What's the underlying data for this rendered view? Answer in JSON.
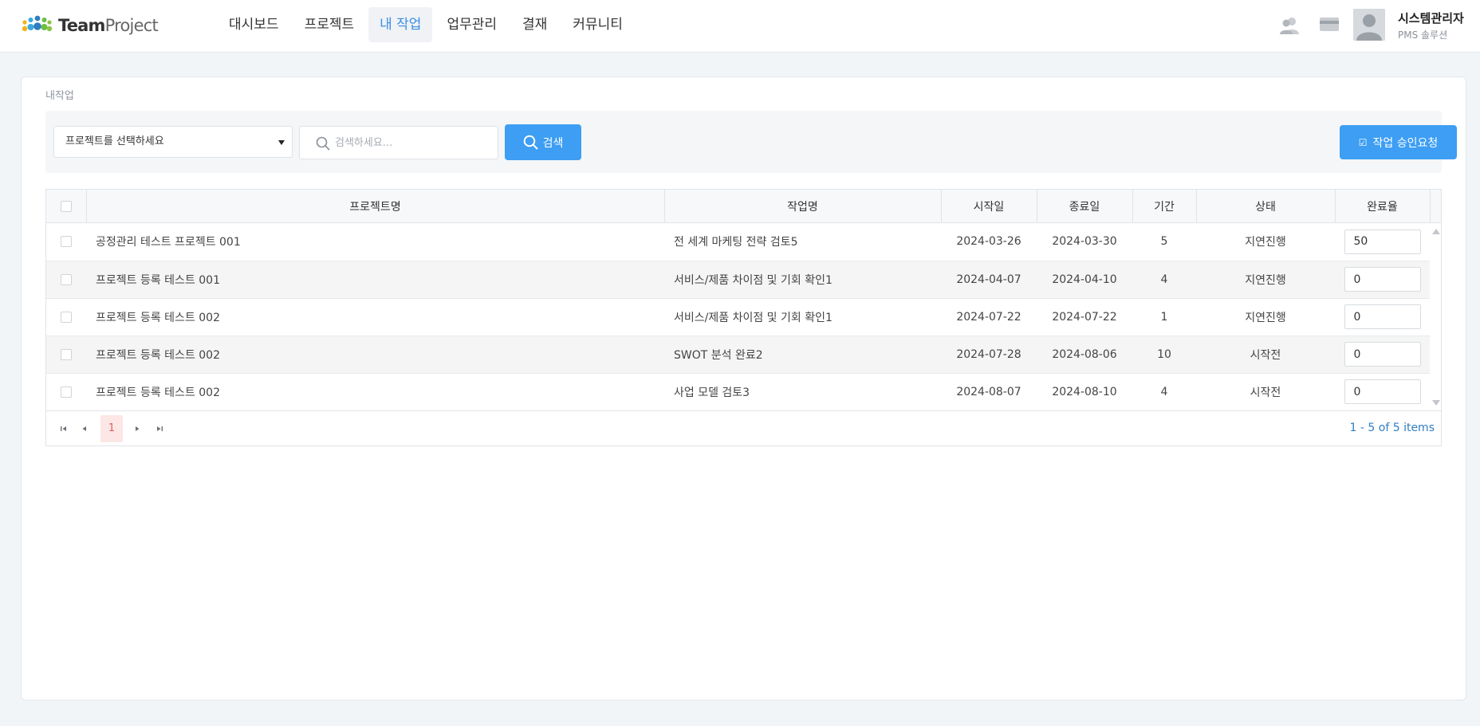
{
  "header": {
    "logo_bold": "Team",
    "logo_light": "Project",
    "nav": [
      {
        "label": "대시보드"
      },
      {
        "label": "프로젝트"
      },
      {
        "label": "내 작업",
        "active": true
      },
      {
        "label": "업무관리"
      },
      {
        "label": "결재"
      },
      {
        "label": "커뮤니티"
      }
    ],
    "user": {
      "name": "시스템관리자",
      "subtitle": "PMS 솔루션"
    },
    "icons": [
      "users-icon",
      "card-icon",
      "avatar"
    ]
  },
  "breadcrumb": "내작업",
  "toolbar": {
    "project_select": "프로젝트를 선택하세요",
    "search_placeholder": "검색하세요...",
    "search_value": "",
    "search_label": "검색",
    "approve_label": "작업 승인요청"
  },
  "grid": {
    "columns": [
      "프로젝트명",
      "작업명",
      "시작일",
      "종료일",
      "기간",
      "상태",
      "완료율"
    ],
    "rows": [
      {
        "project": "공정관리 테스트 프로젝트 001",
        "task": "전 세계 마케팅 전략 검토5",
        "start": "2024-03-26",
        "end": "2024-03-30",
        "duration": "5",
        "status": "지연진행",
        "rate": "50"
      },
      {
        "project": "프로젝트 등록 테스트 001",
        "task": "서비스/제품 차이점 및 기회 확인1",
        "start": "2024-04-07",
        "end": "2024-04-10",
        "duration": "4",
        "status": "지연진행",
        "rate": "0"
      },
      {
        "project": "프로젝트 등록 테스트 002",
        "task": "서비스/제품 차이점 및 기회 확인1",
        "start": "2024-07-22",
        "end": "2024-07-22",
        "duration": "1",
        "status": "지연진행",
        "rate": "0"
      },
      {
        "project": "프로젝트 등록 테스트 002",
        "task": "SWOT 분석 완료2",
        "start": "2024-07-28",
        "end": "2024-08-06",
        "duration": "10",
        "status": "시작전",
        "rate": "0"
      },
      {
        "project": "프로젝트 등록 테스트 002",
        "task": "사업 모델 검토3",
        "start": "2024-08-07",
        "end": "2024-08-10",
        "duration": "4",
        "status": "시작전",
        "rate": "0"
      }
    ],
    "pager": {
      "current_page": "1",
      "info": "1 - 5 of 5 items"
    }
  },
  "colors": {
    "accent": "#3d9ef3",
    "link": "#2f93d5",
    "active_nav": "#3a8ee6",
    "page_highlight": "#fce6e6"
  }
}
